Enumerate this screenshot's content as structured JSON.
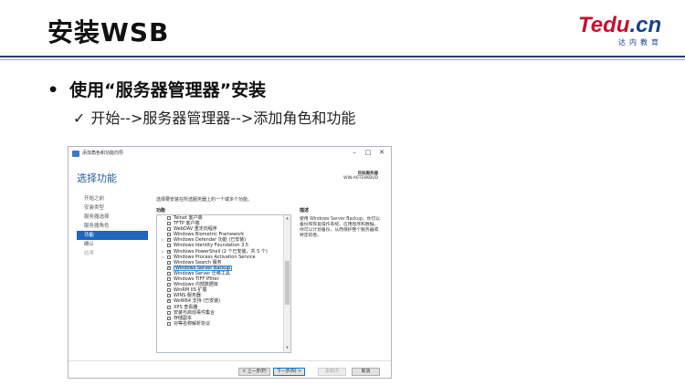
{
  "slide": {
    "title": "安装WSB",
    "bullet": "使用“服务器管理器”安装",
    "bullet_dot": "•",
    "check": "✓",
    "sub": "开始-->服务器管理器-->添加角色和功能"
  },
  "logo": {
    "main_a": "Tedu",
    "main_b": ".cn",
    "sub": "达内教育",
    "colors": {
      "red": "#c8102e",
      "blue": "#1a3f8f"
    }
  },
  "dialog": {
    "window_title": "添加角色和功能向导",
    "window_buttons": {
      "minimize": "–",
      "maximize": "□",
      "close": "✕"
    },
    "header": "选择功能",
    "server_label": "目标服务器",
    "server_name": "WIN-A6TE6KBUD",
    "nav": [
      {
        "label": "开始之前",
        "state": "normal"
      },
      {
        "label": "安装类型",
        "state": "normal"
      },
      {
        "label": "服务器选择",
        "state": "normal"
      },
      {
        "label": "服务器角色",
        "state": "normal"
      },
      {
        "label": "功能",
        "state": "active"
      },
      {
        "label": "确认",
        "state": "normal"
      },
      {
        "label": "结果",
        "state": "disabled"
      }
    ],
    "instruction": "选择要安装在所选服务器上的一个或多个功能。",
    "features_header": "功能",
    "description_header": "描述",
    "features": [
      {
        "label": "Telnet 客户端",
        "state": "unchecked",
        "expand": false
      },
      {
        "label": "TFTP 客户端",
        "state": "unchecked",
        "expand": false
      },
      {
        "label": "WebDAV 重定向程序",
        "state": "unchecked",
        "expand": false
      },
      {
        "label": "Windows Biometric Framework",
        "state": "unchecked",
        "expand": false
      },
      {
        "label": "Windows Defender 功能 (已安装)",
        "state": "checked",
        "expand": true
      },
      {
        "label": "Windows Identity Foundation 3.5",
        "state": "unchecked",
        "expand": false
      },
      {
        "label": "Windows PowerShell (2 个已安装，共 5 个)",
        "state": "partial",
        "expand": true
      },
      {
        "label": "Windows Process Activation Service",
        "state": "unchecked",
        "expand": true
      },
      {
        "label": "Windows Search 服务",
        "state": "unchecked",
        "expand": false
      },
      {
        "label": "Windows Server Backup",
        "state": "checked",
        "expand": false,
        "selected": true
      },
      {
        "label": "Windows Server 迁移工具",
        "state": "unchecked",
        "expand": false
      },
      {
        "label": "Windows TIFF IFilter",
        "state": "unchecked",
        "expand": false
      },
      {
        "label": "Windows 内部数据库",
        "state": "unchecked",
        "expand": false
      },
      {
        "label": "WinRM IIS 扩展",
        "state": "unchecked",
        "expand": false
      },
      {
        "label": "WINS 服务器",
        "state": "unchecked",
        "expand": false
      },
      {
        "label": "WoW64 支持 (已安装)",
        "state": "checked",
        "expand": false
      },
      {
        "label": "XPS 查看器",
        "state": "unchecked",
        "expand": false
      },
      {
        "label": "安装与启动事件集合",
        "state": "unchecked",
        "expand": false
      },
      {
        "label": "存储副本",
        "state": "unchecked",
        "expand": false
      },
      {
        "label": "对等名称解析协议",
        "state": "unchecked",
        "expand": false
      }
    ],
    "description": "使用 Windows Server Backup，你可以备份和恢复操作系统、应用程序和数据。你可以计划备份，从而保护整个服务器或特定的卷。",
    "buttons": {
      "prev": "< 上一步(P)",
      "next": "下一步(N) >",
      "install": "安装(I)",
      "cancel": "取消"
    }
  }
}
